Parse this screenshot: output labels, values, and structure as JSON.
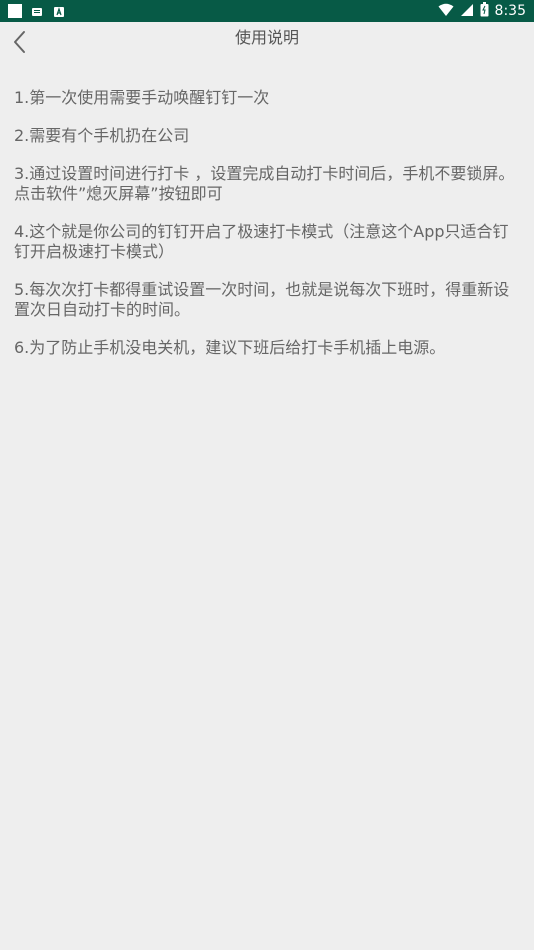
{
  "status_bar": {
    "time": "8:35",
    "icons_left": [
      "white-square-icon",
      "sd-card-icon",
      "text-a-icon"
    ],
    "icons_right": [
      "wifi-icon",
      "signal-icon",
      "battery-icon"
    ],
    "color": "#075a46"
  },
  "header": {
    "title": "使用说明",
    "back_icon": "chevron-left-icon"
  },
  "instructions": [
    "1.第一次使用需要手动唤醒钉钉一次",
    "2.需要有个手机扔在公司",
    "3.通过设置时间进行打卡 ，设置完成自动打卡时间后，手机不要锁屏。点击软件”熄灭屏幕”按钮即可",
    "4.这个就是你公司的钉钉开启了极速打卡模式（注意这个App只适合钉钉开启极速打卡模式）",
    "5.每次次打卡都得重试设置一次时间，也就是说每次下班时，得重新设置次日自动打卡的时间。",
    "6.为了防止手机没电关机，建议下班后给打卡手机插上电源。"
  ]
}
